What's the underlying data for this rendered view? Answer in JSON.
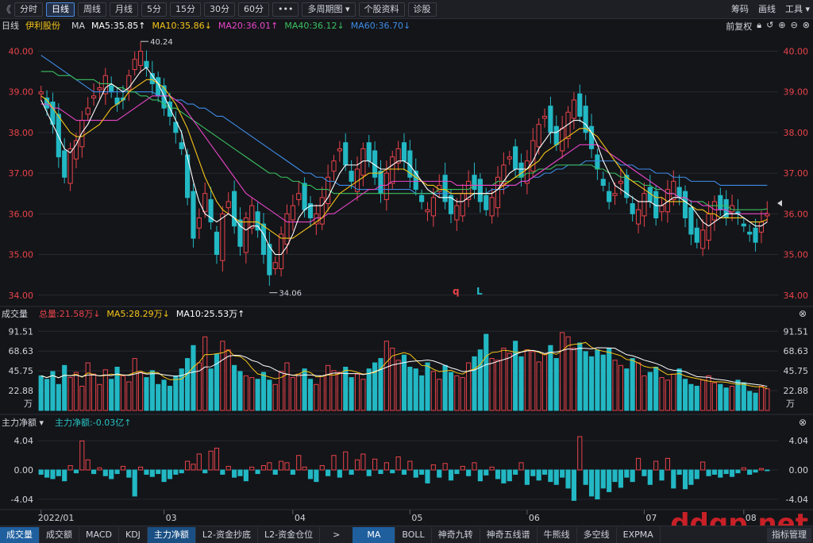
{
  "toolbar": {
    "collapse_glyph": "《",
    "items": [
      "分时",
      "日线",
      "周线",
      "月线",
      "5分",
      "15分",
      "30分",
      "60分",
      "•••",
      "多周期图 ▾",
      "个股资料",
      "诊股"
    ],
    "active_index": 1,
    "right": [
      "筹码",
      "画线",
      "工具 ▾"
    ]
  },
  "price_legend": {
    "period": "日线",
    "stock": "伊利股份",
    "ma_label": "MA",
    "ma5": "MA5:35.85↑",
    "ma10": "MA10:35.86↓",
    "ma20": "MA20:36.01↑",
    "ma40": "MA40:36.12↓",
    "ma60": "MA60:36.70↓",
    "adjust": "前复权",
    "colors": {
      "ma5": "#ffffff",
      "ma10": "#f5c518",
      "ma20": "#e845c8",
      "ma40": "#3ac060",
      "ma60": "#3d8ce6"
    }
  },
  "price_axis": {
    "ticks": [
      "40.00",
      "39.00",
      "38.00",
      "37.00",
      "36.00",
      "35.00",
      "34.00"
    ],
    "max_label": "40.24",
    "min_label": "34.06",
    "marker_q": "q",
    "marker_l": "L"
  },
  "volume_legend": {
    "title": "成交量",
    "total": "总量:21.58万↓",
    "ma5": "MA5:28.29万↓",
    "ma10": "MA10:25.53万↑"
  },
  "volume_axis": {
    "ticks": [
      "91.51",
      "68.63",
      "45.75",
      "22.88"
    ],
    "unit": "万"
  },
  "flow_legend": {
    "title": "主力净额 ▾",
    "value": "主力净额:-0.03亿↑"
  },
  "flow_axis": {
    "ticks": [
      "4.04",
      "0.00",
      "-4.04"
    ]
  },
  "date_axis": {
    "labels": [
      "2022/01",
      "03",
      "04",
      "05",
      "06",
      "07",
      "08"
    ]
  },
  "bottombar": {
    "left_tabs": [
      "成交量",
      "成交额",
      "MACD",
      "KDJ",
      "主力净额",
      "L2-资金抄底",
      "L2-资金仓位"
    ],
    "arrow": ">",
    "right_tabs": [
      "MA",
      "BOLL",
      "神奇九转",
      "神奇五线谱",
      "牛熊线",
      "多空线",
      "EXPMA"
    ],
    "far_right": "指标管理"
  },
  "watermark": "ddgp.net",
  "chart_data": {
    "type": "candlestick",
    "ylim": [
      33.8,
      40.4
    ],
    "closes": [
      39.0,
      38.6,
      38.2,
      37.4,
      36.9,
      37.6,
      37.8,
      38.3,
      38.6,
      38.9,
      39.1,
      39.4,
      39.0,
      38.7,
      38.8,
      39.4,
      39.8,
      40.0,
      39.6,
      39.2,
      38.9,
      38.6,
      38.4,
      38.0,
      37.6,
      36.4,
      35.4,
      35.9,
      36.5,
      35.8,
      35.0,
      36.0,
      36.3,
      35.7,
      35.2,
      35.9,
      36.2,
      35.6,
      35.0,
      34.5,
      34.8,
      35.5,
      36.0,
      36.2,
      36.5,
      36.1,
      35.9,
      36.0,
      36.4,
      36.9,
      37.3,
      37.6,
      37.2,
      36.8,
      37.1,
      37.6,
      37.3,
      36.9,
      36.5,
      37.0,
      37.4,
      37.6,
      37.3,
      36.9,
      36.6,
      36.3,
      36.1,
      36.4,
      36.7,
      36.3,
      36.0,
      36.2,
      36.5,
      36.8,
      36.6,
      36.3,
      36.1,
      36.4,
      36.9,
      37.2,
      37.4,
      37.1,
      36.9,
      37.3,
      37.8,
      38.2,
      38.4,
      38.0,
      37.7,
      38.1,
      38.5,
      38.8,
      38.4,
      38.0,
      37.6,
      37.1,
      36.7,
      36.3,
      36.5,
      36.8,
      36.4,
      36.0,
      36.1,
      36.5,
      36.3,
      35.9,
      36.2,
      36.6,
      36.8,
      36.4,
      35.9,
      35.5,
      35.3,
      35.6,
      36.0,
      36.3,
      36.1,
      35.9,
      36.2,
      36.0,
      35.7,
      35.5,
      35.3,
      35.8,
      36.0
    ],
    "ma5": [
      38.8,
      38.5,
      38.2,
      37.9,
      37.6,
      37.5,
      37.7,
      38.0,
      38.2,
      38.5,
      38.8,
      39.1,
      39.2,
      39.1,
      39.0,
      39.1,
      39.3,
      39.5,
      39.6,
      39.4,
      39.2,
      38.9,
      38.6,
      38.3,
      38.0,
      37.4,
      36.8,
      36.3,
      36.0,
      35.9,
      35.8,
      35.9,
      36.0,
      35.9,
      35.7,
      35.6,
      35.7,
      35.7,
      35.5,
      35.2,
      35.0,
      35.0,
      35.2,
      35.5,
      35.9,
      36.1,
      36.2,
      36.2,
      36.2,
      36.4,
      36.7,
      37.0,
      37.2,
      37.2,
      37.2,
      37.3,
      37.3,
      37.2,
      37.1,
      37.1,
      37.2,
      37.3,
      37.3,
      37.2,
      37.0,
      36.8,
      36.6,
      36.5,
      36.4,
      36.4,
      36.4,
      36.3,
      36.3,
      36.4,
      36.5,
      36.5,
      36.5,
      36.5,
      36.6,
      36.8,
      37.0,
      37.1,
      37.1,
      37.1,
      37.3,
      37.6,
      37.8,
      38.0,
      38.0,
      38.1,
      38.2,
      38.3,
      38.3,
      38.2,
      38.0,
      37.7,
      37.3,
      37.0,
      36.7,
      36.6,
      36.5,
      36.4,
      36.3,
      36.3,
      36.3,
      36.2,
      36.2,
      36.3,
      36.4,
      36.4,
      36.3,
      36.2,
      36.0,
      35.8,
      35.7,
      35.8,
      35.9,
      36.0,
      36.0,
      36.0,
      35.9,
      35.8,
      35.7,
      35.7,
      35.8
    ],
    "ma10": [
      38.9,
      38.8,
      38.6,
      38.4,
      38.2,
      38.0,
      37.9,
      37.9,
      38.0,
      38.1,
      38.2,
      38.4,
      38.6,
      38.7,
      38.8,
      39.0,
      39.1,
      39.2,
      39.3,
      39.3,
      39.2,
      39.1,
      38.9,
      38.7,
      38.4,
      38.1,
      37.7,
      37.3,
      36.9,
      36.6,
      36.3,
      36.1,
      36.0,
      35.9,
      35.8,
      35.8,
      35.8,
      35.8,
      35.7,
      35.6,
      35.5,
      35.4,
      35.4,
      35.4,
      35.5,
      35.6,
      35.7,
      35.8,
      35.9,
      36.1,
      36.3,
      36.5,
      36.6,
      36.7,
      36.8,
      36.9,
      37.0,
      37.0,
      37.0,
      37.1,
      37.1,
      37.1,
      37.1,
      37.0,
      36.9,
      36.8,
      36.7,
      36.7,
      36.6,
      36.6,
      36.5,
      36.5,
      36.5,
      36.5,
      36.5,
      36.5,
      36.5,
      36.5,
      36.6,
      36.7,
      36.8,
      36.9,
      37.0,
      37.1,
      37.2,
      37.3,
      37.5,
      37.6,
      37.7,
      37.8,
      37.9,
      38.0,
      38.1,
      38.1,
      38.0,
      37.9,
      37.7,
      37.5,
      37.3,
      37.1,
      36.9,
      36.8,
      36.7,
      36.6,
      36.5,
      36.4,
      36.4,
      36.3,
      36.3,
      36.3,
      36.3,
      36.2,
      36.1,
      36.1,
      36.0,
      36.0,
      35.9,
      35.9,
      35.9,
      35.9,
      35.9,
      35.8,
      35.8,
      35.8,
      35.86
    ],
    "ma20": [
      38.7,
      38.7,
      38.6,
      38.6,
      38.5,
      38.4,
      38.3,
      38.3,
      38.3,
      38.3,
      38.3,
      38.3,
      38.3,
      38.3,
      38.4,
      38.5,
      38.6,
      38.7,
      38.8,
      38.9,
      38.9,
      38.9,
      38.9,
      38.8,
      38.7,
      38.5,
      38.3,
      38.1,
      37.9,
      37.7,
      37.5,
      37.3,
      37.1,
      36.9,
      36.7,
      36.5,
      36.4,
      36.3,
      36.2,
      36.1,
      36.0,
      35.9,
      35.8,
      35.8,
      35.8,
      35.8,
      35.8,
      35.9,
      35.9,
      36.0,
      36.0,
      36.1,
      36.2,
      36.3,
      36.4,
      36.5,
      36.6,
      36.6,
      36.7,
      36.7,
      36.8,
      36.8,
      36.8,
      36.8,
      36.8,
      36.8,
      36.8,
      36.8,
      36.8,
      36.8,
      36.8,
      36.7,
      36.7,
      36.7,
      36.7,
      36.7,
      36.7,
      36.7,
      36.7,
      36.7,
      36.7,
      36.7,
      36.8,
      36.8,
      36.9,
      37.0,
      37.1,
      37.2,
      37.3,
      37.4,
      37.5,
      37.6,
      37.7,
      37.7,
      37.7,
      37.7,
      37.6,
      37.5,
      37.4,
      37.3,
      37.2,
      37.1,
      37.0,
      36.9,
      36.8,
      36.7,
      36.6,
      36.5,
      36.5,
      36.4,
      36.4,
      36.3,
      36.3,
      36.2,
      36.2,
      36.1,
      36.1,
      36.1,
      36.0,
      36.0,
      36.0,
      36.0,
      36.0,
      36.0,
      36.01
    ],
    "ma40": [
      39.5,
      39.5,
      39.5,
      39.4,
      39.4,
      39.4,
      39.3,
      39.3,
      39.3,
      39.3,
      39.2,
      39.2,
      39.2,
      39.1,
      39.1,
      39.0,
      39.0,
      38.9,
      38.9,
      38.8,
      38.8,
      38.7,
      38.6,
      38.6,
      38.5,
      38.4,
      38.3,
      38.2,
      38.1,
      38.0,
      37.9,
      37.8,
      37.7,
      37.6,
      37.5,
      37.4,
      37.3,
      37.2,
      37.1,
      37.0,
      37.0,
      36.9,
      36.9,
      36.8,
      36.8,
      36.7,
      36.7,
      36.6,
      36.6,
      36.6,
      36.5,
      36.5,
      36.5,
      36.5,
      36.5,
      36.5,
      36.5,
      36.5,
      36.5,
      36.5,
      36.5,
      36.5,
      36.5,
      36.5,
      36.5,
      36.5,
      36.5,
      36.5,
      36.6,
      36.6,
      36.6,
      36.6,
      36.6,
      36.6,
      36.7,
      36.7,
      36.7,
      36.7,
      36.8,
      36.8,
      36.8,
      36.9,
      36.9,
      37.0,
      37.0,
      37.1,
      37.1,
      37.1,
      37.2,
      37.2,
      37.2,
      37.2,
      37.2,
      37.2,
      37.2,
      37.1,
      37.1,
      37.0,
      37.0,
      36.9,
      36.9,
      36.8,
      36.8,
      36.7,
      36.7,
      36.6,
      36.6,
      36.5,
      36.5,
      36.4,
      36.4,
      36.3,
      36.3,
      36.3,
      36.2,
      36.2,
      36.2,
      36.2,
      36.1,
      36.1,
      36.1,
      36.1,
      36.1,
      36.1,
      36.12
    ],
    "ma60": [
      39.9,
      39.8,
      39.7,
      39.6,
      39.5,
      39.4,
      39.3,
      39.2,
      39.1,
      39.0,
      39.0,
      39.0,
      39.0,
      39.0,
      39.0,
      39.0,
      39.0,
      39.0,
      39.0,
      39.0,
      38.9,
      38.9,
      38.9,
      38.8,
      38.8,
      38.7,
      38.7,
      38.6,
      38.6,
      38.5,
      38.4,
      38.4,
      38.3,
      38.2,
      38.1,
      38.0,
      37.9,
      37.8,
      37.7,
      37.6,
      37.5,
      37.4,
      37.3,
      37.2,
      37.1,
      37.0,
      37.0,
      36.9,
      36.9,
      36.8,
      36.8,
      36.7,
      36.7,
      36.7,
      36.6,
      36.6,
      36.6,
      36.6,
      36.6,
      36.6,
      36.6,
      36.6,
      36.6,
      36.6,
      36.5,
      36.5,
      36.5,
      36.5,
      36.5,
      36.5,
      36.5,
      36.5,
      36.5,
      36.5,
      36.5,
      36.5,
      36.5,
      36.6,
      36.6,
      36.6,
      36.7,
      36.7,
      36.8,
      36.8,
      36.9,
      36.9,
      37.0,
      37.0,
      37.1,
      37.1,
      37.2,
      37.2,
      37.2,
      37.3,
      37.3,
      37.3,
      37.3,
      37.3,
      37.3,
      37.2,
      37.2,
      37.2,
      37.1,
      37.1,
      37.1,
      37.0,
      37.0,
      37.0,
      36.9,
      36.9,
      36.9,
      36.8,
      36.8,
      36.8,
      36.8,
      36.8,
      36.7,
      36.7,
      36.7,
      36.7,
      36.7,
      36.7,
      36.7,
      36.7,
      36.7
    ],
    "volume": [
      40,
      36,
      45,
      30,
      52,
      38,
      44,
      28,
      55,
      42,
      30,
      47,
      36,
      50,
      40,
      33,
      60,
      44,
      38,
      46,
      30,
      35,
      28,
      40,
      48,
      60,
      75,
      55,
      85,
      48,
      65,
      80,
      70,
      52,
      45,
      40,
      38,
      36,
      44,
      35,
      30,
      45,
      55,
      38,
      42,
      48,
      36,
      30,
      40,
      52,
      46,
      44,
      50,
      38,
      42,
      36,
      48,
      55,
      60,
      80,
      72,
      58,
      64,
      50,
      48,
      40,
      55,
      45,
      36,
      52,
      44,
      40,
      38,
      55,
      62,
      70,
      88,
      60,
      58,
      72,
      66,
      80,
      62,
      70,
      68,
      56,
      65,
      75,
      60,
      90,
      85,
      72,
      78,
      68,
      62,
      70,
      64,
      72,
      58,
      52,
      48,
      60,
      55,
      40,
      44,
      50,
      38,
      35,
      42,
      48,
      36,
      30,
      28,
      35,
      40,
      32,
      30,
      26,
      28,
      35,
      32,
      22,
      20,
      28,
      25
    ],
    "flow": [
      -0.6,
      -1.0,
      -1.2,
      -0.8,
      -1.5,
      0.6,
      -0.4,
      4.0,
      1.4,
      -0.5,
      0.3,
      -0.8,
      -1.2,
      -0.5,
      0.5,
      -1.0,
      -3.6,
      0.4,
      -0.6,
      -0.9,
      -0.5,
      -1.6,
      -1.2,
      -0.6,
      -0.4,
      1.2,
      0.8,
      2.2,
      -0.4,
      2.6,
      3.0,
      -0.6,
      0.5,
      -1.0,
      -0.8,
      -1.5,
      0.4,
      -0.5,
      0.6,
      1.0,
      -0.6,
      1.2,
      1.0,
      -0.6,
      2.0,
      0.4,
      -1.2,
      -1.6,
      0.6,
      -0.8,
      2.0,
      -1.0,
      2.5,
      -0.6,
      1.4,
      2.2,
      -0.8,
      1.5,
      -0.5,
      1.0,
      -0.4,
      1.8,
      -0.6,
      1.2,
      -1.0,
      -0.6,
      -1.8,
      0.7,
      -1.0,
      0.9,
      -1.4,
      -0.5,
      0.5,
      -0.8,
      1.0,
      -1.5,
      -0.7,
      0.4,
      -1.2,
      -1.8,
      -1.5,
      -0.6,
      1.0,
      -2.0,
      -0.8,
      -1.4,
      -0.6,
      -1.6,
      -2.0,
      -1.0,
      -2.5,
      -4.2,
      4.6,
      -2.0,
      -3.6,
      -4.0,
      -2.5,
      -3.0,
      -1.6,
      -2.4,
      -1.0,
      -1.6,
      1.6,
      -0.8,
      -2.0,
      1.2,
      -1.4,
      1.6,
      -2.5,
      -0.6,
      -2.6,
      -2.0,
      -1.2,
      1.1,
      -0.8,
      -0.6,
      -1.0,
      -0.5,
      -0.9,
      -0.4,
      0.3,
      -0.6,
      -0.3,
      0.2,
      -0.1
    ]
  }
}
